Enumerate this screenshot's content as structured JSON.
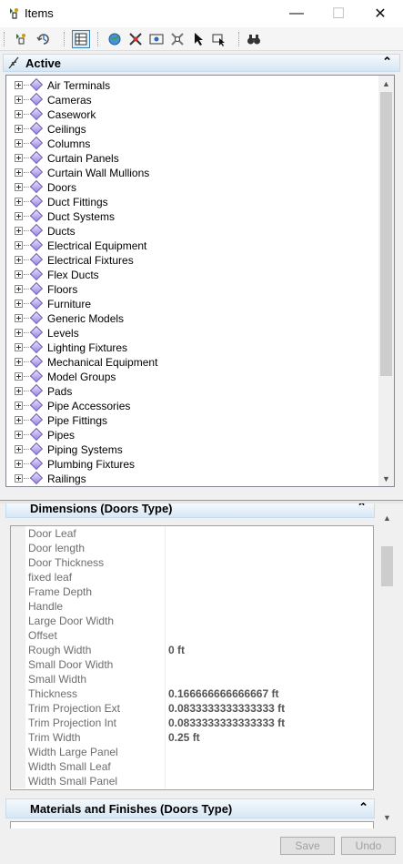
{
  "window": {
    "title": "Items",
    "minimize": "—",
    "maximize": "☐",
    "close": "✕"
  },
  "toolbar": {
    "buttons": [
      "add-item",
      "refresh",
      "grid-view",
      "globe",
      "filter-remove",
      "zoom-box",
      "scatter",
      "select-pointer",
      "select-options",
      "find-binoculars"
    ]
  },
  "active_section": {
    "title": "Active",
    "collapse": "⌃"
  },
  "tree": {
    "items": [
      "Air Terminals",
      "Cameras",
      "Casework",
      "Ceilings",
      "Columns",
      "Curtain Panels",
      "Curtain Wall Mullions",
      "Doors",
      "Duct Fittings",
      "Duct Systems",
      "Ducts",
      "Electrical Equipment",
      "Electrical Fixtures",
      "Flex Ducts",
      "Floors",
      "Furniture",
      "Generic Models",
      "Levels",
      "Lighting Fixtures",
      "Mechanical Equipment",
      "Model Groups",
      "Pads",
      "Pipe Accessories",
      "Pipe Fittings",
      "Pipes",
      "Piping Systems",
      "Plumbing Fixtures",
      "Railings"
    ]
  },
  "dimensions": {
    "title": "Dimensions (Doors Type)",
    "collapse": "⌃",
    "rows": [
      {
        "name": "Door Leaf",
        "value": ""
      },
      {
        "name": "Door length",
        "value": ""
      },
      {
        "name": "Door Thickness",
        "value": ""
      },
      {
        "name": "fixed leaf",
        "value": ""
      },
      {
        "name": "Frame Depth",
        "value": ""
      },
      {
        "name": "Handle",
        "value": ""
      },
      {
        "name": "Large Door Width",
        "value": ""
      },
      {
        "name": "Offset",
        "value": ""
      },
      {
        "name": "Rough Width",
        "value": "0 ft"
      },
      {
        "name": "Small Door Width",
        "value": ""
      },
      {
        "name": "Small Width",
        "value": ""
      },
      {
        "name": "Thickness",
        "value": "0.166666666666667 ft"
      },
      {
        "name": "Trim Projection Ext",
        "value": "0.0833333333333333 ft"
      },
      {
        "name": "Trim Projection Int",
        "value": "0.0833333333333333 ft"
      },
      {
        "name": "Trim Width",
        "value": "0.25 ft"
      },
      {
        "name": "Width Large Panel",
        "value": ""
      },
      {
        "name": "Width Small Leaf",
        "value": ""
      },
      {
        "name": "Width Small Panel",
        "value": ""
      }
    ]
  },
  "materials": {
    "title": "Materials and Finishes (Doors Type)",
    "collapse": "⌃"
  },
  "footer": {
    "save": "Save",
    "undo": "Undo"
  }
}
